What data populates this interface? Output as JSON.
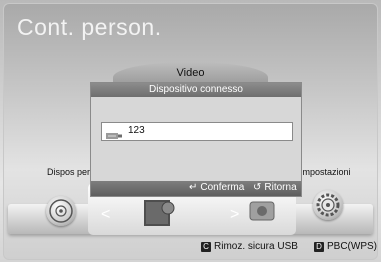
{
  "screen": {
    "title": "Cont. person."
  },
  "menu": {
    "current": "Video",
    "left_label": "Dispos per",
    "right_label": "Impostazioni"
  },
  "dialog": {
    "title": "Dispositivo connesso",
    "devices": [
      {
        "label": "123",
        "icon": "usb-drive-icon"
      }
    ],
    "footer": [
      {
        "label": "Conferma",
        "icon": "enter-icon"
      },
      {
        "label": "Ritorna",
        "icon": "return-icon"
      }
    ]
  },
  "bottom": [
    {
      "key": "C",
      "label": "Rimoz. sicura USB"
    },
    {
      "key": "D",
      "label": "PBC(WPS)"
    }
  ]
}
